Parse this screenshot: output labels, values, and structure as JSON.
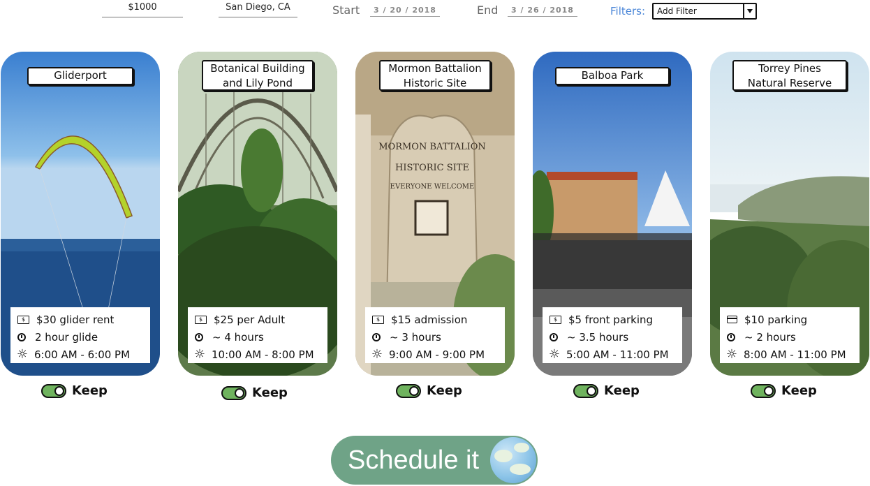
{
  "topbar": {
    "budget": "$1000",
    "location": "San Diego, CA",
    "start_label": "Start",
    "start_date": "3 / 20 / 2018",
    "end_label": "End",
    "end_date": "3 / 26 / 2018",
    "filters_label": "Filters:",
    "filter_select": "Add Filter"
  },
  "cards": [
    {
      "title": "Gliderport",
      "cost": "$30 glider rent",
      "duration": "2 hour glide",
      "hours": "6:00 AM - 6:00 PM",
      "cost_icon": "money-icon",
      "keep": "Keep"
    },
    {
      "title": "Botanical Building and Lily Pond",
      "cost": "$25 per Adult",
      "duration": "~ 4 hours",
      "hours": "10:00 AM - 8:00 PM",
      "cost_icon": "money-icon",
      "keep": "Keep"
    },
    {
      "title": "Mormon Battalion Historic Site",
      "cost": "$15 admission",
      "duration": "~ 3 hours",
      "hours": "9:00 AM - 9:00 PM",
      "cost_icon": "money-icon",
      "keep": "Keep"
    },
    {
      "title": "Balboa Park",
      "cost": "$5 front parking",
      "duration": "~ 3.5 hours",
      "hours": "5:00 AM - 11:00 PM",
      "cost_icon": "money-icon",
      "keep": "Keep"
    },
    {
      "title": "Torrey Pines Natural Reserve",
      "cost": "$10 parking",
      "duration": "~ 2 hours",
      "hours": "8:00 AM - 11:00 PM",
      "cost_icon": "credit-card-icon",
      "keep": "Keep"
    }
  ],
  "sign_text": "MORMON BATTALION HISTORIC SITE EVERYONE WELCOME",
  "schedule_button": "Schedule it",
  "colors": {
    "accent": "#6fa387",
    "toggle": "#6fb35e",
    "filters": "#4a86d8"
  }
}
